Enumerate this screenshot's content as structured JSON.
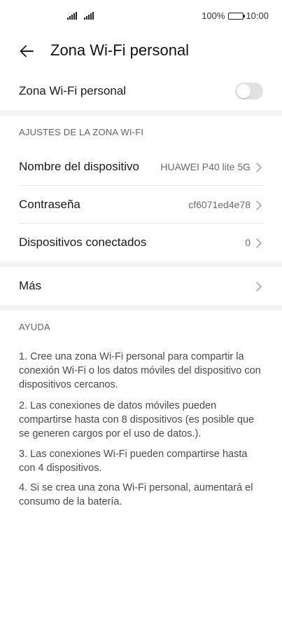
{
  "status_bar": {
    "battery_percent": "100%",
    "time": "10:00"
  },
  "header": {
    "title": "Zona Wi-Fi personal"
  },
  "toggle": {
    "label": "Zona Wi-Fi personal",
    "enabled": false
  },
  "settings_section": {
    "header": "AJUSTES DE LA ZONA WI-FI",
    "rows": [
      {
        "label": "Nombre del dispositivo",
        "value": "HUAWEI P40 lite 5G"
      },
      {
        "label": "Contraseña",
        "value": "cf6071ed4e78"
      },
      {
        "label": "Dispositivos conectados",
        "value": "0"
      }
    ]
  },
  "more": {
    "label": "Más"
  },
  "help": {
    "header": "AYUDA",
    "items": [
      "1. Cree una zona Wi-Fi personal para compartir la conexión Wi-Fi o los datos móviles del dispositivo con dispositivos cercanos.",
      "2. Las conexiones de datos móviles pueden compartirse hasta con 8 dispositivos (es posible que se generen cargos por el uso de datos.).",
      "3. Las conexiones Wi-Fi pueden compartirse hasta con 4 dispositivos.",
      "4. Si se crea una zona Wi-Fi personal, aumentará el consumo de la batería."
    ]
  }
}
